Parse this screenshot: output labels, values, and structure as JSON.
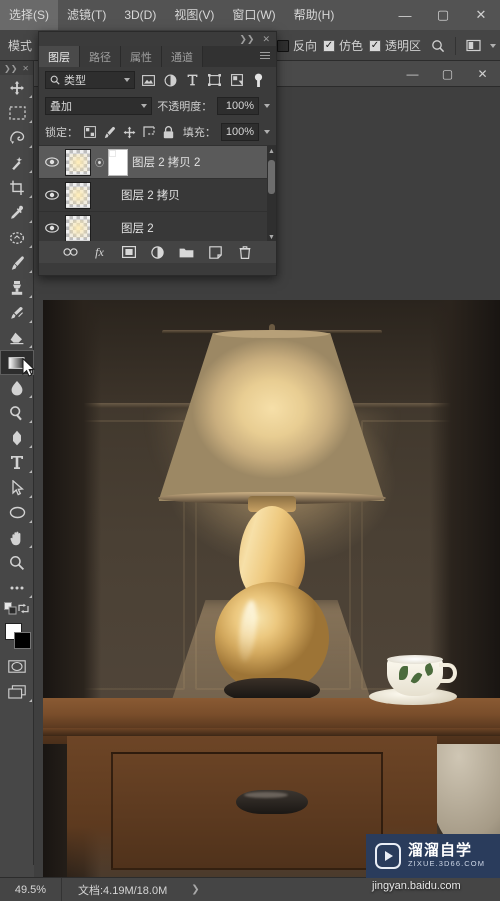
{
  "menubar": {
    "items": [
      {
        "label": "选择(S)",
        "name": "menu-select"
      },
      {
        "label": "滤镜(T)",
        "name": "menu-filter"
      },
      {
        "label": "3D(D)",
        "name": "menu-3d"
      },
      {
        "label": "视图(V)",
        "name": "menu-view"
      },
      {
        "label": "窗口(W)",
        "name": "menu-window"
      },
      {
        "label": "帮助(H)",
        "name": "menu-help"
      }
    ],
    "window_buttons": {
      "minimize": "—",
      "maximize": "▢",
      "close": "✕"
    }
  },
  "options_bar": {
    "mode_label": "模式",
    "reverse": {
      "label": "反向",
      "checked": false
    },
    "dither": {
      "label": "仿色",
      "checked": true
    },
    "transparency": {
      "label": "透明区",
      "checked": true
    },
    "search_icon": "search-icon",
    "mask_icon": "mask-preview-icon",
    "overflow_caret": "⌄"
  },
  "toolbar": {
    "collapse": "❯❯",
    "close": "✕",
    "tools": [
      {
        "name": "move-tool",
        "label": "移动工具"
      },
      {
        "name": "marquee-tool",
        "label": "矩形选框工具"
      },
      {
        "name": "lasso-tool",
        "label": "套索工具"
      },
      {
        "name": "quick-selection-tool",
        "label": "快速选择工具"
      },
      {
        "name": "crop-tool",
        "label": "裁剪工具"
      },
      {
        "name": "eyedropper-tool",
        "label": "吸管工具"
      },
      {
        "name": "patch-tool",
        "label": "污点修复画笔工具"
      },
      {
        "name": "brush-tool",
        "label": "画笔工具"
      },
      {
        "name": "clone-stamp-tool",
        "label": "仿制图章工具"
      },
      {
        "name": "history-brush-tool",
        "label": "历史记录画笔工具"
      },
      {
        "name": "eraser-tool",
        "label": "橡皮擦工具"
      },
      {
        "name": "gradient-tool",
        "label": "渐变工具",
        "selected": true
      },
      {
        "name": "blur-tool",
        "label": "模糊工具"
      },
      {
        "name": "dodge-tool",
        "label": "减淡工具"
      },
      {
        "name": "pen-tool",
        "label": "钢笔工具"
      },
      {
        "name": "type-tool",
        "label": "横排文字工具"
      },
      {
        "name": "path-selection-tool",
        "label": "路径选择工具"
      },
      {
        "name": "ellipse-tool",
        "label": "椭圆工具"
      },
      {
        "name": "hand-tool",
        "label": "抓手工具"
      },
      {
        "name": "zoom-tool",
        "label": "缩放工具"
      },
      {
        "name": "edit-toolbar-tool",
        "label": "编辑工具栏"
      }
    ],
    "swap_colors_icon": "swap-colors-icon",
    "default_colors_icon": "default-colors-icon",
    "foreground_color": "#ffffff",
    "background_color": "#000000",
    "quick_mask_icon": "quick-mask-icon",
    "screen_mode_icon": "screen-mode-icon"
  },
  "document_window": {
    "buttons": {
      "minimize": "—",
      "maximize": "▢",
      "close": "✕"
    }
  },
  "layers_panel": {
    "collapse_icon": "❯❯",
    "close_icon": "✕",
    "menu_icon": "panel-menu-icon",
    "tabs": [
      {
        "label": "图层",
        "active": true,
        "name": "tab-layers"
      },
      {
        "label": "路径",
        "active": false,
        "name": "tab-paths"
      },
      {
        "label": "属性",
        "active": false,
        "name": "tab-properties"
      },
      {
        "label": "通道",
        "active": false,
        "name": "tab-channels"
      }
    ],
    "filter": {
      "search_icon": "search-icon",
      "kind_label": "类型",
      "icons": [
        {
          "name": "filter-pixel-icon"
        },
        {
          "name": "filter-adjustment-icon"
        },
        {
          "name": "filter-type-icon"
        },
        {
          "name": "filter-shape-icon"
        },
        {
          "name": "filter-smart-object-icon"
        }
      ],
      "toggle_icon": "filter-power-toggle-icon"
    },
    "blend_mode": "叠加",
    "opacity_label": "不透明度：",
    "opacity_value": "100%",
    "lock_label": "锁定：",
    "lock_icons": [
      {
        "name": "lock-transparent-pixels-icon"
      },
      {
        "name": "lock-image-pixels-icon"
      },
      {
        "name": "lock-position-icon"
      },
      {
        "name": "lock-artboard-nesting-icon"
      },
      {
        "name": "lock-all-icon"
      }
    ],
    "fill_label": "填充：",
    "fill_value": "100%",
    "layers": [
      {
        "name": "图层 2 拷贝 2",
        "visible": true,
        "selected": true,
        "has_mask": true
      },
      {
        "name": "图层 2 拷贝",
        "visible": true,
        "selected": false,
        "has_mask": false
      },
      {
        "name": "图层 2",
        "visible": true,
        "selected": false,
        "has_mask": false
      }
    ],
    "footer_icons": [
      {
        "name": "link-layers-icon",
        "glyph": "∞"
      },
      {
        "name": "layer-style-fx-icon",
        "glyph": "fx"
      },
      {
        "name": "add-layer-mask-icon",
        "glyph": "◙"
      },
      {
        "name": "new-adjustment-layer-icon",
        "glyph": "◐"
      },
      {
        "name": "new-group-icon",
        "glyph": "▰"
      },
      {
        "name": "new-layer-icon",
        "glyph": "❐"
      },
      {
        "name": "delete-layer-icon",
        "glyph": "🗑"
      }
    ]
  },
  "statusbar": {
    "zoom": "49.5%",
    "doc_info": "文档:4.19M/18.0M",
    "expand_arrow": "❯"
  },
  "watermark": {
    "title": "溜溜自学",
    "subtitle": "ZIXUE.3D66.COM",
    "caption": "jingyan.baidu.com",
    "brand_color": "#2a3c5c"
  },
  "canvas": {
    "description": "暖色台灯静物照片"
  }
}
